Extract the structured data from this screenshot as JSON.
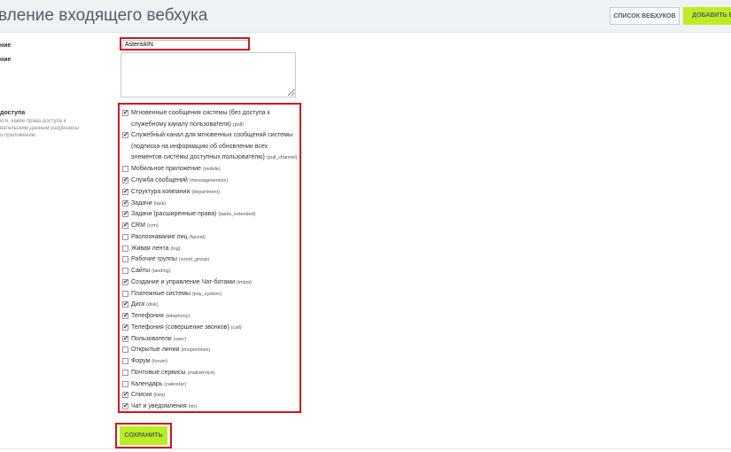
{
  "header": {
    "title": "вление входящего вебхука",
    "star": "☆",
    "list_button": "СПИСОК ВЕБХУКОВ",
    "add_button": "ДОБАВИТЬ ВЕБ"
  },
  "form": {
    "name_label": "ние",
    "name_value": "AsteriskIN",
    "description_label": "ние",
    "access_label": "доступа",
    "access_hint_lines": [
      "ите, какие права доступа к",
      "вательским данным разрешены",
      "о приложению"
    ],
    "scopes": [
      {
        "label": "Мгновенные сообщения системы (без доступа к служебному каналу пользователя)",
        "code": "(pull)",
        "checked": true
      },
      {
        "label": "Служебный канал для мгновенных сообщений системы (подписка на информацию об обновлении всех элементов системы доступных пользователю)",
        "code": "(pull_channel)",
        "checked": true
      },
      {
        "label": "Мобильное приложение",
        "code": "(mobile)",
        "checked": false
      },
      {
        "label": "Служба сообщений",
        "code": "(messageservice)",
        "checked": true
      },
      {
        "label": "Структура компании",
        "code": "(department)",
        "checked": true
      },
      {
        "label": "Задачи",
        "code": "(task)",
        "checked": true
      },
      {
        "label": "Задачи (расширенные права)",
        "code": "(tasks_extended)",
        "checked": true
      },
      {
        "label": "CRM",
        "code": "(crm)",
        "checked": true
      },
      {
        "label": "Распознавание лиц",
        "code": "(faceid)",
        "checked": false
      },
      {
        "label": "Живая лента",
        "code": "(log)",
        "checked": false
      },
      {
        "label": "Рабочие группы",
        "code": "(sonet_group)",
        "checked": false
      },
      {
        "label": "Сайты",
        "code": "(landing)",
        "checked": false
      },
      {
        "label": "Создание и управление Чат-ботами",
        "code": "(imbot)",
        "checked": true
      },
      {
        "label": "Платежные системы",
        "code": "(pay_system)",
        "checked": false
      },
      {
        "label": "Диск",
        "code": "(disk)",
        "checked": true
      },
      {
        "label": "Телефония",
        "code": "(telephony)",
        "checked": true
      },
      {
        "label": "Телефония (совершение звонков)",
        "code": "(call)",
        "checked": true
      },
      {
        "label": "Пользователи",
        "code": "(user)",
        "checked": true
      },
      {
        "label": "Открытые линии",
        "code": "(imopenlines)",
        "checked": false
      },
      {
        "label": "Форум",
        "code": "(forum)",
        "checked": false
      },
      {
        "label": "Почтовые сервисы",
        "code": "(mailservice)",
        "checked": false
      },
      {
        "label": "Календарь",
        "code": "(calendar)",
        "checked": false
      },
      {
        "label": "Списки",
        "code": "(lists)",
        "checked": true
      },
      {
        "label": "Чат и уведомления",
        "code": "(im)",
        "checked": true
      }
    ],
    "save_button": "СОХРАНИТЬ"
  },
  "colors": {
    "accent_green": "#bbed21",
    "highlight_red": "#d2161c"
  }
}
